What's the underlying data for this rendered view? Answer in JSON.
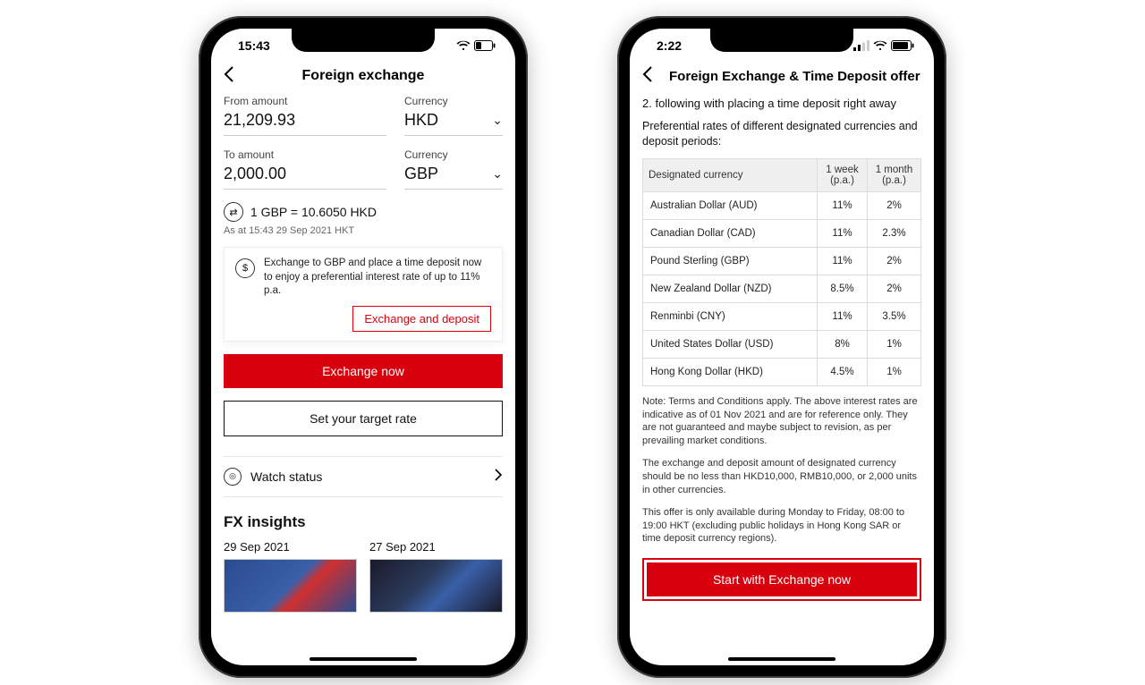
{
  "phone1": {
    "status_time": "15:43",
    "nav_title": "Foreign exchange",
    "from_label": "From amount",
    "from_value": "21,209.93",
    "from_currency_label": "Currency",
    "from_currency": "HKD",
    "to_label": "To amount",
    "to_value": "2,000.00",
    "to_currency_label": "Currency",
    "to_currency": "GBP",
    "rate_text": "1 GBP = 10.6050 HKD",
    "rate_timestamp": "As at 15:43 29 Sep 2021 HKT",
    "promo_text": "Exchange to GBP and place a time deposit now to enjoy a preferential interest rate of up to 11% p.a.",
    "promo_link": "Exchange and deposit",
    "exchange_now": "Exchange now",
    "set_target": "Set your target rate",
    "watch_status": "Watch status",
    "fx_insights": "FX insights",
    "insight1_date": "29 Sep 2021",
    "insight2_date": "27 Sep 2021"
  },
  "phone2": {
    "status_time": "2:22",
    "nav_title": "Foreign Exchange & Time Deposit offer",
    "intro": "2. following with placing a time deposit right away",
    "subheading": "Preferential rates of different designated currencies and deposit periods:",
    "table": {
      "headers": [
        "Designated currency",
        "1 week (p.a.)",
        "1 month (p.a.)"
      ],
      "rows": [
        [
          "Australian Dollar (AUD)",
          "11%",
          "2%"
        ],
        [
          "Canadian Dollar (CAD)",
          "11%",
          "2.3%"
        ],
        [
          "Pound Sterling (GBP)",
          "11%",
          "2%"
        ],
        [
          "New Zealand Dollar (NZD)",
          "8.5%",
          "2%"
        ],
        [
          "Renminbi (CNY)",
          "11%",
          "3.5%"
        ],
        [
          "United States Dollar (USD)",
          "8%",
          "1%"
        ],
        [
          "Hong Kong Dollar (HKD)",
          "4.5%",
          "1%"
        ]
      ]
    },
    "note1": "Note: Terms and Conditions apply. The above interest rates are indicative as of 01 Nov 2021 and are for reference only.  They are not guaranteed and maybe subject to revision, as per prevailing market conditions.",
    "note2": "The exchange and deposit amount of designated currency should be no less than HKD10,000, RMB10,000, or 2,000 units in other currencies.",
    "note3": "This offer is only available during Monday to Friday, 08:00 to 19:00 HKT (excluding public holidays in Hong Kong SAR or time deposit currency regions).",
    "cta": "Start with Exchange now"
  }
}
